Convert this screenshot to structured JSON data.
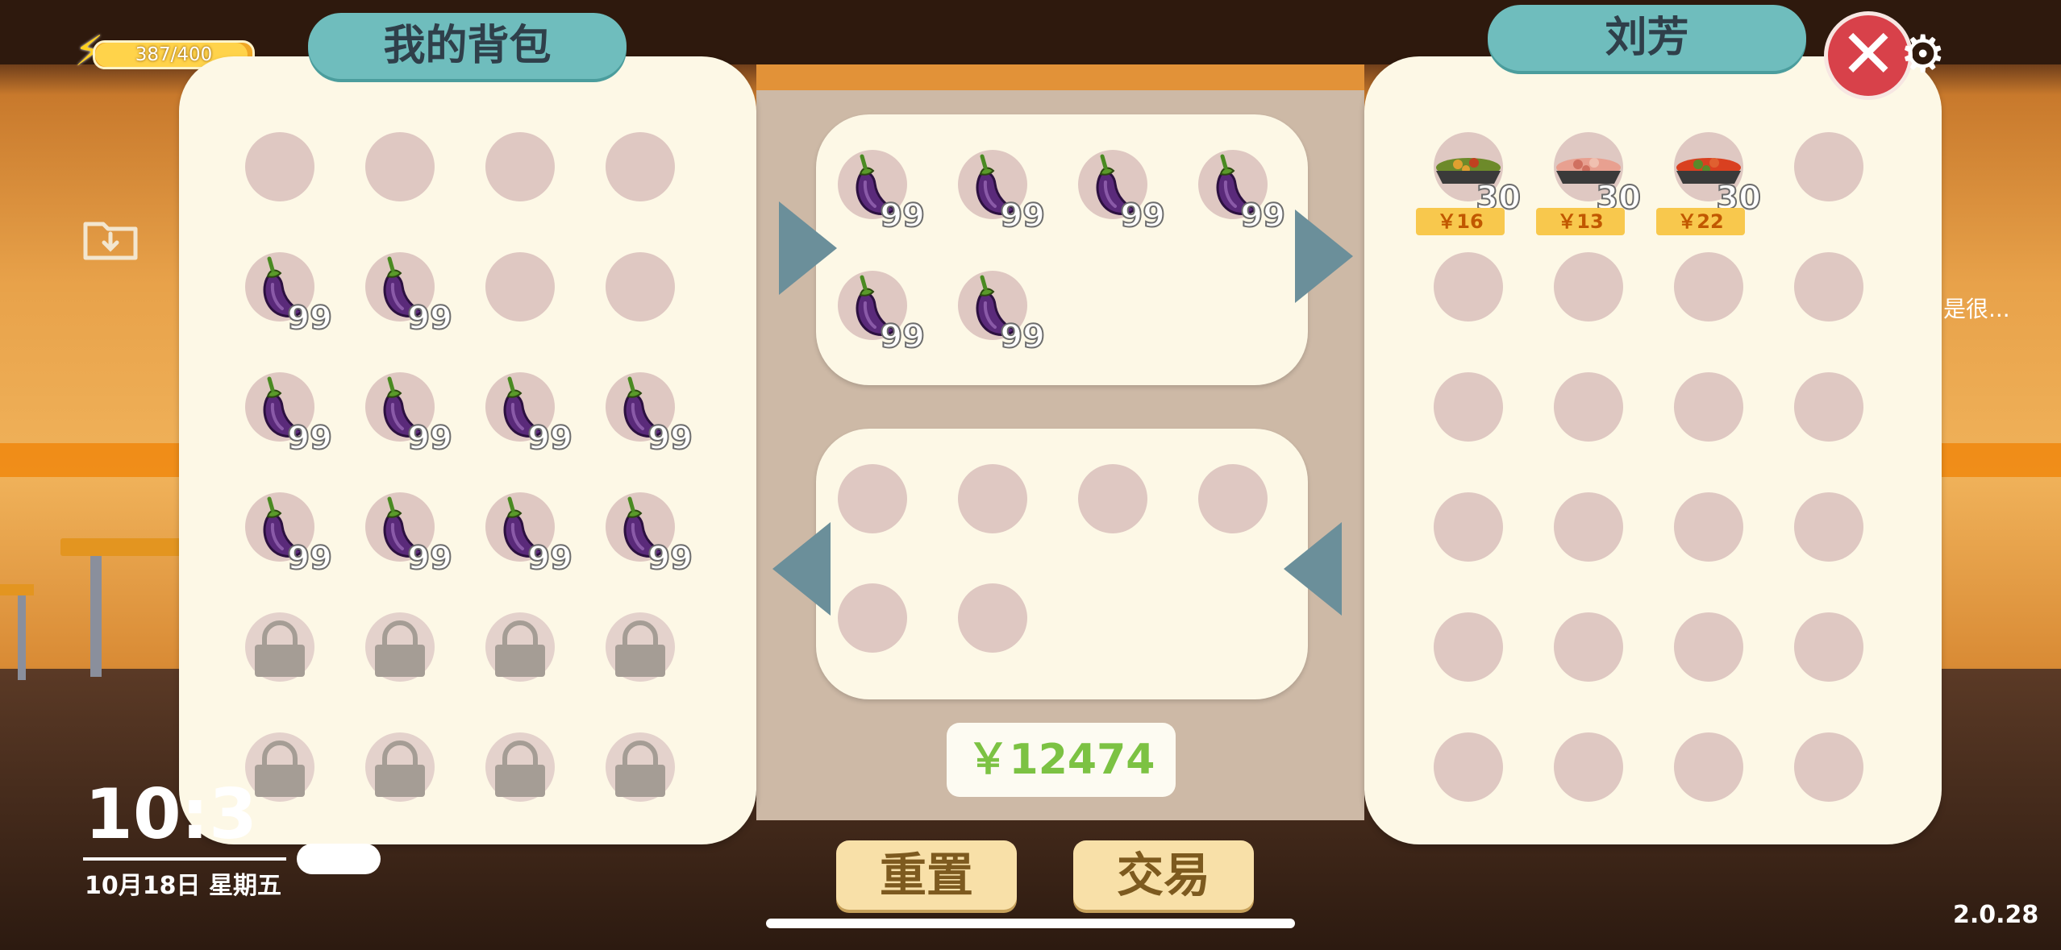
{
  "hud": {
    "energy_text": "387/400",
    "energy_fraction": 0.9675,
    "time": "10:3",
    "date": "10月18日 星期五",
    "version": "2.0.28",
    "side_text": "是很..."
  },
  "left_panel": {
    "title": "我的背包",
    "rows": [
      [
        "empty",
        "empty",
        "empty",
        "empty"
      ],
      [
        "eggplant:99",
        "eggplant:99",
        "empty",
        "empty"
      ],
      [
        "eggplant:99",
        "eggplant:99",
        "eggplant:99",
        "eggplant:99"
      ],
      [
        "eggplant:99",
        "eggplant:99",
        "eggplant:99",
        "eggplant:99"
      ],
      [
        "locked",
        "locked",
        "locked",
        "locked"
      ],
      [
        "locked",
        "locked",
        "locked",
        "locked"
      ]
    ]
  },
  "offer_box": {
    "rows": [
      [
        "eggplant:99",
        "eggplant:99",
        "eggplant:99",
        "eggplant:99"
      ],
      [
        "eggplant:99",
        "eggplant:99"
      ]
    ]
  },
  "receive_box": {
    "rows": [
      [
        "empty",
        "empty",
        "empty",
        "empty"
      ],
      [
        "empty",
        "empty"
      ]
    ]
  },
  "money": "￥12474",
  "buttons": {
    "reset": "重置",
    "trade": "交易"
  },
  "right_panel": {
    "title": "刘芳",
    "items": [
      {
        "dish": "stir-fry-dish",
        "count": "30",
        "price": "￥16"
      },
      {
        "dish": "meat-dish",
        "count": "30",
        "price": "￥13"
      },
      {
        "dish": "tomato-dish",
        "count": "30",
        "price": "￥22"
      }
    ]
  },
  "icons": {
    "close": "close-icon",
    "settings": "gear-icon",
    "energy": "lightning-icon",
    "save": "folder-download-icon"
  }
}
